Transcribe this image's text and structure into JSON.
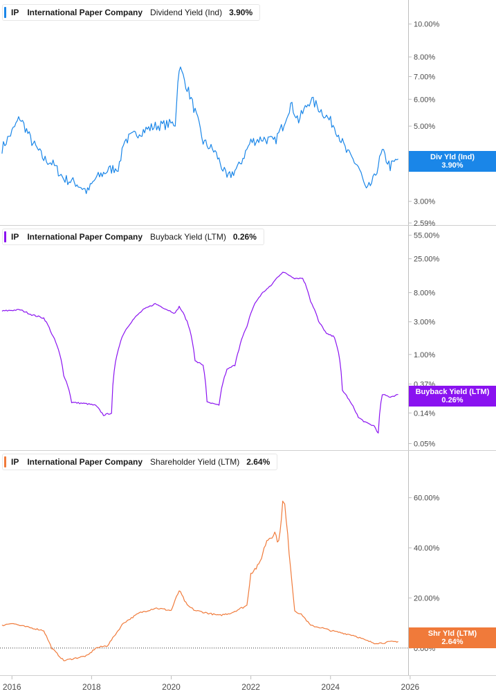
{
  "colors": {
    "dividend": "#1a86e8",
    "buyback": "#8a12f0",
    "shareholder": "#f07a3a",
    "grid": "#d8d8d8",
    "tick": "#4a4a4a"
  },
  "legends": [
    {
      "symbol": "IP",
      "company": "International Paper Company",
      "metric": "Dividend Yield (Ind)",
      "value": "3.90%"
    },
    {
      "symbol": "IP",
      "company": "International Paper Company",
      "metric": "Buyback Yield (LTM)",
      "value": "0.26%"
    },
    {
      "symbol": "IP",
      "company": "International Paper Company",
      "metric": "Shareholder Yield (LTM)",
      "value": "2.64%"
    }
  ],
  "tags": [
    {
      "line1": "Div Yld (Ind)",
      "line2": "3.90%"
    },
    {
      "line1": "Buyback Yield (LTM)",
      "line2": "0.26%"
    },
    {
      "line1": "Shr Yld (LTM)",
      "line2": "2.64%"
    }
  ],
  "chart_data": [
    {
      "type": "line",
      "series": [
        {
          "name": "Dividend Yield (Ind)",
          "x": [
            2015.75,
            2016.0,
            2016.2,
            2016.5,
            2016.8,
            2017.0,
            2017.3,
            2017.6,
            2017.9,
            2018.1,
            2018.4,
            2018.7,
            2018.8,
            2019.2,
            2019.6,
            2020.1,
            2020.2,
            2020.5,
            2020.8,
            2021.1,
            2021.4,
            2021.7,
            2022.0,
            2022.3,
            2022.6,
            2022.8,
            2023.0,
            2023.2,
            2023.5,
            2023.8,
            2024.1,
            2024.4,
            2024.7,
            2024.9,
            2025.1,
            2025.3,
            2025.5,
            2025.7
          ],
          "y": [
            4.3,
            4.8,
            5.3,
            4.5,
            4.0,
            3.9,
            3.5,
            3.4,
            3.2,
            3.5,
            3.7,
            3.8,
            4.5,
            4.8,
            5.0,
            5.1,
            7.5,
            6.0,
            4.5,
            4.2,
            3.5,
            3.8,
            4.5,
            4.6,
            4.5,
            5.0,
            5.8,
            5.2,
            6.0,
            5.5,
            5.0,
            4.2,
            3.8,
            3.2,
            3.5,
            4.2,
            3.8,
            4.0
          ]
        }
      ],
      "yticks": [
        "10.00%",
        "8.00%",
        "7.00%",
        "6.00%",
        "5.00%",
        "4.00%",
        "3.00%",
        "2.59%"
      ],
      "scale": "log",
      "ylim": [
        2.59,
        11.5
      ]
    },
    {
      "type": "line",
      "series": [
        {
          "name": "Buyback Yield (LTM)",
          "x": [
            2015.75,
            2016.2,
            2016.5,
            2016.8,
            2017.0,
            2017.2,
            2017.3,
            2017.5,
            2017.9,
            2018.1,
            2018.3,
            2018.5,
            2018.8,
            2019.0,
            2019.3,
            2019.6,
            2019.9,
            2020.1,
            2020.2,
            2020.4,
            2020.6,
            2020.8,
            2020.9,
            2021.2,
            2021.4,
            2021.6,
            2021.7,
            2021.9,
            2022.1,
            2022.3,
            2022.5,
            2022.7,
            2022.8,
            2023.1,
            2023.3,
            2023.5,
            2023.7,
            2023.9,
            2024.1,
            2024.3,
            2024.5,
            2024.7,
            2024.9,
            2025.1,
            2025.2,
            2025.3,
            2025.5,
            2025.7
          ],
          "y": [
            4.3,
            4.5,
            3.8,
            3.4,
            2.0,
            1.0,
            0.5,
            0.2,
            0.19,
            0.18,
            0.13,
            0.14,
            2.0,
            3.0,
            4.5,
            5.5,
            4.5,
            4.0,
            5.0,
            3.0,
            0.8,
            0.7,
            0.2,
            0.18,
            0.6,
            0.7,
            1.2,
            2.5,
            5.5,
            8.0,
            10.0,
            14.0,
            16.0,
            13.0,
            13.0,
            6.0,
            3.0,
            2.0,
            1.8,
            0.3,
            0.2,
            0.12,
            0.1,
            0.09,
            0.07,
            0.26,
            0.24,
            0.26
          ]
        }
      ],
      "yticks": [
        "55.00%",
        "25.00%",
        "8.00%",
        "3.00%",
        "1.00%",
        "0.37%",
        "0.14%",
        "0.05%"
      ],
      "scale": "log",
      "ylim": [
        0.042,
        60
      ]
    },
    {
      "type": "line",
      "series": [
        {
          "name": "Shareholder Yield (LTM)",
          "x": [
            2015.75,
            2016.0,
            2016.2,
            2016.5,
            2016.8,
            2017.0,
            2017.3,
            2017.6,
            2017.9,
            2018.1,
            2018.4,
            2018.8,
            2019.2,
            2019.6,
            2020.0,
            2020.2,
            2020.4,
            2020.6,
            2020.9,
            2021.2,
            2021.5,
            2021.9,
            2022.0,
            2022.2,
            2022.4,
            2022.6,
            2022.7,
            2022.8,
            2022.85,
            2023.0,
            2023.1,
            2023.3,
            2023.5,
            2023.8,
            2024.0,
            2024.3,
            2024.6,
            2024.9,
            2025.1,
            2025.3,
            2025.5,
            2025.7
          ],
          "y": [
            9,
            10,
            9,
            8,
            7,
            0,
            -5,
            -4,
            -3,
            0,
            1,
            10,
            14,
            16,
            15,
            23,
            17,
            15,
            14,
            13,
            14,
            17,
            30,
            33,
            43,
            46,
            42,
            58,
            57,
            32,
            15,
            13,
            9,
            8,
            7,
            6,
            5,
            3,
            2,
            2,
            2.5,
            2.64
          ]
        }
      ],
      "yticks": [
        "60.00%",
        "40.00%",
        "20.00%",
        "0.00%"
      ],
      "scale": "linear",
      "ylim": [
        -10,
        74
      ]
    }
  ],
  "xaxis": {
    "ticks": [
      "2016",
      "2018",
      "2020",
      "2022",
      "2024",
      "2026"
    ],
    "range": [
      2015.7,
      2025.95
    ]
  }
}
